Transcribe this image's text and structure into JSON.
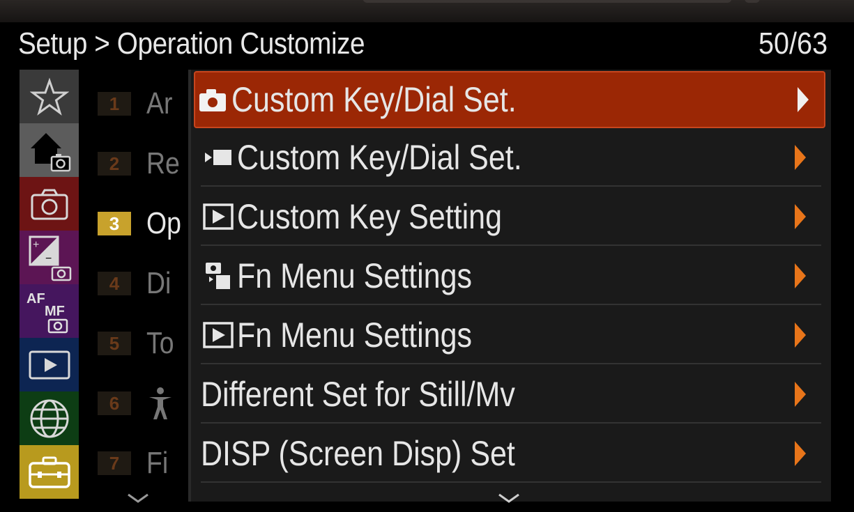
{
  "header": {
    "title": "Setup > Operation Customize",
    "page_indicator": "50/63"
  },
  "categories": [
    {
      "name": "my-menu",
      "icon": "star-icon",
      "color": "#3a3a3a",
      "active": false
    },
    {
      "name": "main",
      "icon": "home-camera-icon",
      "color": "#5a5a5a",
      "active": true
    },
    {
      "name": "shooting",
      "icon": "camera-icon",
      "color": "#7a1515",
      "active": false
    },
    {
      "name": "exposure-color",
      "icon": "exposure-camera-icon",
      "color": "#6b1a5a",
      "active": false
    },
    {
      "name": "focus",
      "icon": "af-mf-icon",
      "color": "#4a1a6a",
      "active": false
    },
    {
      "name": "playback",
      "icon": "playback-icon",
      "color": "#0f2a5a",
      "active": false
    },
    {
      "name": "network",
      "icon": "globe-icon",
      "color": "#0f4a1a",
      "active": false
    },
    {
      "name": "setup",
      "icon": "toolbox-icon",
      "color": "#b89a1e",
      "active": true
    }
  ],
  "pages": [
    {
      "num": "1",
      "label": "Ar",
      "active": false
    },
    {
      "num": "2",
      "label": "Re",
      "active": false
    },
    {
      "num": "3",
      "label": "Op",
      "active": true
    },
    {
      "num": "4",
      "label": "Di",
      "active": false
    },
    {
      "num": "5",
      "label": "To",
      "active": false
    },
    {
      "num": "6",
      "label": "",
      "icon": "accessibility-icon",
      "active": false
    },
    {
      "num": "7",
      "label": "Fi",
      "active": false
    }
  ],
  "menu_items": [
    {
      "icon": "still-camera-icon",
      "label": "Custom Key/Dial Set.",
      "selected": true
    },
    {
      "icon": "movie-icon",
      "label": "Custom Key/Dial Set.",
      "selected": false
    },
    {
      "icon": "playback-icon",
      "label": "Custom Key Setting",
      "selected": false
    },
    {
      "icon": "fn-still-movie-icon",
      "label": "Fn Menu Settings",
      "selected": false
    },
    {
      "icon": "playback-icon",
      "label": "Fn Menu Settings",
      "selected": false
    },
    {
      "icon": "",
      "label": "Different Set for Still/Mv",
      "selected": false
    },
    {
      "icon": "",
      "label": "DISP (Screen Disp) Set",
      "selected": false
    }
  ],
  "colors": {
    "selected_bg": "#9b2705",
    "arrow": "#e8751a",
    "active_page": "#c8a22c"
  }
}
